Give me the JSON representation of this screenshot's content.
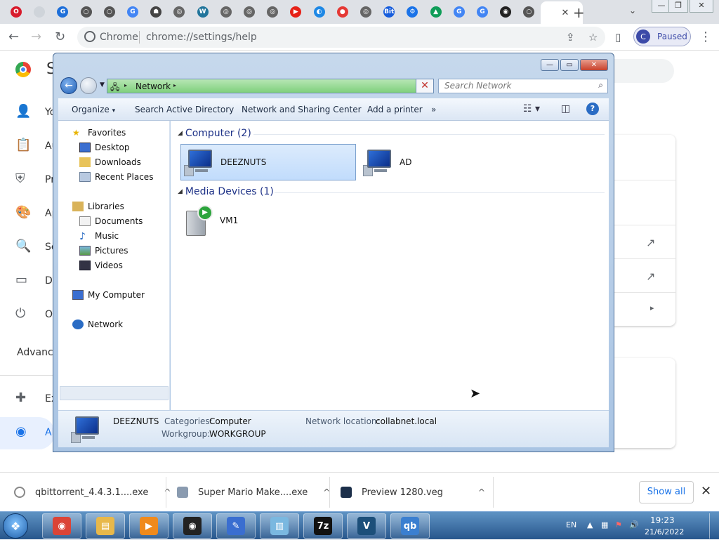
{
  "browser": {
    "tabs_favicons": [
      {
        "name": "opera-icon",
        "color": "#d81b2c",
        "glyph": "O"
      },
      {
        "name": "page-icon",
        "color": "#cfd4da",
        "glyph": ""
      },
      {
        "name": "google-docs-icon",
        "color": "#1e6fd9",
        "glyph": "G"
      },
      {
        "name": "chrome-icon",
        "color": "#555",
        "glyph": "○"
      },
      {
        "name": "chrome-icon",
        "color": "#555",
        "glyph": "○"
      },
      {
        "name": "google-icon",
        "color": "#4285f4",
        "glyph": "G"
      },
      {
        "name": "extension-icon",
        "color": "#444",
        "glyph": "☗"
      },
      {
        "name": "globe-icon",
        "color": "#666",
        "glyph": "◎"
      },
      {
        "name": "wordpress-icon",
        "color": "#21759b",
        "glyph": "W"
      },
      {
        "name": "globe-icon",
        "color": "#666",
        "glyph": "◎"
      },
      {
        "name": "globe-icon",
        "color": "#666",
        "glyph": "◎"
      },
      {
        "name": "globe-icon",
        "color": "#666",
        "glyph": "◎"
      },
      {
        "name": "youtube-icon",
        "color": "#e62117",
        "glyph": "▶"
      },
      {
        "name": "app-icon",
        "color": "#1e88e5",
        "glyph": "◐"
      },
      {
        "name": "drop-icon",
        "color": "#e53935",
        "glyph": "●"
      },
      {
        "name": "globe-icon",
        "color": "#666",
        "glyph": "◎"
      },
      {
        "name": "bitwarden-icon",
        "color": "#175ddc",
        "glyph": "Bit"
      },
      {
        "name": "gear-icon",
        "color": "#1a73e8",
        "glyph": "⚙"
      },
      {
        "name": "google-drive-icon",
        "color": "#0f9d58",
        "glyph": "▲"
      },
      {
        "name": "google-icon",
        "color": "#4285f4",
        "glyph": "G"
      },
      {
        "name": "google-icon",
        "color": "#4285f4",
        "glyph": "G"
      },
      {
        "name": "obs-icon",
        "color": "#222",
        "glyph": "◉"
      },
      {
        "name": "chrome-icon",
        "color": "#555",
        "glyph": "○"
      }
    ],
    "active_tab_close": "✕",
    "new_tab": "+",
    "tab_search": "⌄",
    "window_controls": [
      "—",
      "❐",
      "✕"
    ],
    "site_label": "Chrome",
    "url": "chrome://settings/help",
    "profile_initial": "C",
    "profile_status": "Paused"
  },
  "settings": {
    "items": [
      {
        "icon": "person-icon",
        "glyph": "👤",
        "label": "Yo"
      },
      {
        "icon": "clipboard-icon",
        "glyph": "📋",
        "label": "Au"
      },
      {
        "icon": "shield-icon",
        "glyph": "⛨",
        "label": "Pr"
      },
      {
        "icon": "palette-icon",
        "glyph": "🎨",
        "label": "Ap"
      },
      {
        "icon": "search-icon",
        "glyph": "🔍",
        "label": "Se"
      },
      {
        "icon": "browser-icon",
        "glyph": "▭",
        "label": "De"
      },
      {
        "icon": "power-icon",
        "glyph": "⏻",
        "label": "On"
      }
    ],
    "advanced_label": "Advance",
    "extensions_label": "Ex",
    "about_label": "Al"
  },
  "explorer": {
    "address": {
      "root_arrow": "▸",
      "crumb": "Network",
      "crumb_arrow": "▸"
    },
    "search_placeholder": "Search Network",
    "commands": [
      "Organize",
      "Search Active Directory",
      "Network and Sharing Center",
      "Add a printer",
      "»"
    ],
    "organize_arrow": "▾",
    "nav": {
      "favorites": "Favorites",
      "desktop": "Desktop",
      "downloads": "Downloads",
      "recent": "Recent Places",
      "libraries": "Libraries",
      "documents": "Documents",
      "music": "Music",
      "pictures": "Pictures",
      "videos": "Videos",
      "my_computer": "My Computer",
      "network": "Network"
    },
    "groups": [
      {
        "title": "Computer (2)",
        "items": [
          "DEEZNUTS",
          "AD"
        ]
      },
      {
        "title": "Media Devices (1)",
        "items": [
          "VM1"
        ]
      }
    ],
    "details": {
      "name": "DEEZNUTS",
      "categories_label": "Categories:",
      "categories_value": "Computer",
      "workgroup_label": "Workgroup:",
      "workgroup_value": "WORKGROUP",
      "location_label": "Network location:",
      "location_value": "collabnet.local"
    }
  },
  "downloads": {
    "items": [
      {
        "name": "qbittorrent_4.4.3.1....exe",
        "icon": "installer-icon"
      },
      {
        "name": "Super Mario Make....exe",
        "icon": "installer-icon"
      },
      {
        "name": "Preview 1280.veg",
        "icon": "vegas-file-icon"
      }
    ],
    "chevron": "^",
    "show_all": "Show all",
    "close": "✕"
  },
  "taskbar": {
    "apps": [
      {
        "name": "chrome-taskbar",
        "color": "#db4437",
        "glyph": "◉"
      },
      {
        "name": "explorer-taskbar",
        "color": "#e8b84a",
        "glyph": "▤"
      },
      {
        "name": "media-player-taskbar",
        "color": "#f08a1c",
        "glyph": "▶"
      },
      {
        "name": "obs-taskbar",
        "color": "#222",
        "glyph": "◉"
      },
      {
        "name": "paint-taskbar",
        "color": "#3a6ed0",
        "glyph": "✎"
      },
      {
        "name": "notepad-taskbar",
        "color": "#7ab8e0",
        "glyph": "▥"
      },
      {
        "name": "7zip-taskbar",
        "color": "#111",
        "glyph": "7z"
      },
      {
        "name": "vegas-taskbar",
        "color": "#1c4f7a",
        "glyph": "V"
      },
      {
        "name": "qbittorrent-taskbar",
        "color": "#3b7fd0",
        "glyph": "qb"
      }
    ],
    "language": "EN",
    "time": "19:23",
    "date": "21/6/2022"
  }
}
